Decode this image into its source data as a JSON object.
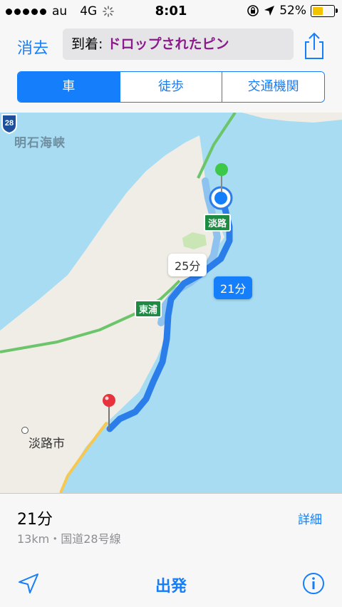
{
  "status_bar": {
    "carrier": "au",
    "network": "4G",
    "time": "8:01",
    "battery": "52%",
    "battery_level": 0.52
  },
  "header": {
    "clear_label": "消去",
    "destination_label": "到着: ",
    "destination_value": "ドロップされたピン",
    "share_icon": "share-icon"
  },
  "transport_modes": {
    "car": "車",
    "walk": "徒歩",
    "transit": "交通機関",
    "selected": "車"
  },
  "map": {
    "strait_label": "明石海峡",
    "city_label": "淡路市",
    "sign_awaji": "淡路",
    "sign_higashiura": "東浦",
    "route_shield": "28",
    "alt_route_time": "25分",
    "main_route_time": "21分"
  },
  "route_info": {
    "time": "21分",
    "summary": "13km・国道28号線",
    "detail_label": "詳細"
  },
  "toolbar": {
    "start_label": "出発",
    "location_icon": "location-arrow-icon",
    "info_icon": "info-icon"
  },
  "colors": {
    "accent": "#147efb",
    "route": "#2b7de9",
    "alt_route": "#8ec3ef",
    "water": "#a7dcf3",
    "land": "#efede6",
    "destination_pin": "#e8323c",
    "start_pin": "#3ec84a"
  }
}
